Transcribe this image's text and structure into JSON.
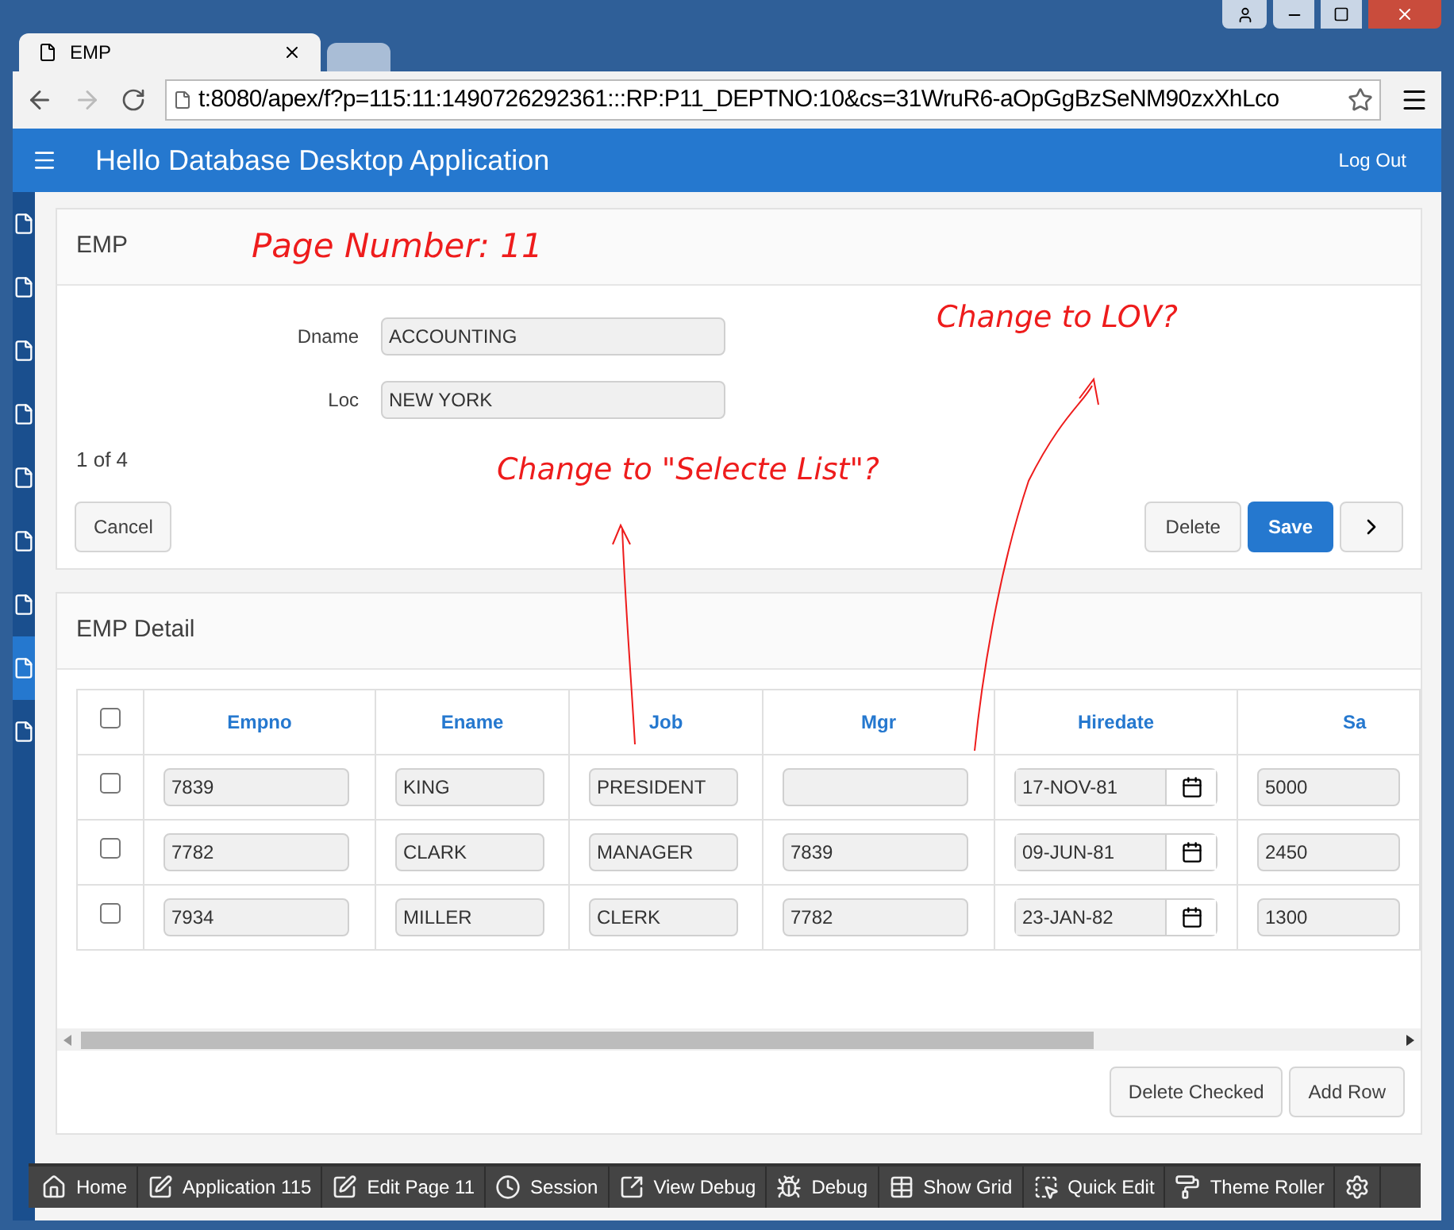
{
  "browser": {
    "tabs": [
      {
        "title": "EMP",
        "selected": true
      },
      {
        "selected": false
      }
    ],
    "address": "t:8080/apex/f?p=115:11:1490726292361:::RP:P11_DEPTNO:10&cs=31WruR6-aOpGgBzSeNM90zxXhLco"
  },
  "header": {
    "title": "Hello Database Desktop Application",
    "logout": "Log Out"
  },
  "sidebar": {
    "items": [
      {
        "selected": false
      },
      {
        "selected": false
      },
      {
        "selected": false
      },
      {
        "selected": false
      },
      {
        "selected": false
      },
      {
        "selected": false
      },
      {
        "selected": false
      },
      {
        "selected": true
      },
      {
        "selected": false
      }
    ]
  },
  "form": {
    "title": "EMP",
    "fields": [
      {
        "label": "Dname",
        "value": "ACCOUNTING"
      },
      {
        "label": "Loc",
        "value": "NEW YORK"
      }
    ],
    "pagination": "1 of 4",
    "buttons": {
      "cancel": "Cancel",
      "delete": "Delete",
      "save": "Save"
    }
  },
  "detail": {
    "title": "EMP Detail",
    "select_all_checked": false,
    "columns": [
      "Empno",
      "Ename",
      "Job",
      "Mgr",
      "Hiredate",
      "Sa"
    ],
    "rows": [
      {
        "checked": false,
        "cells": [
          "7839",
          "KING",
          "PRESIDENT",
          "",
          "17-NOV-81",
          "5000"
        ]
      },
      {
        "checked": false,
        "cells": [
          "7782",
          "CLARK",
          "MANAGER",
          "7839",
          "09-JUN-81",
          "2450"
        ]
      },
      {
        "checked": false,
        "cells": [
          "7934",
          "MILLER",
          "CLERK",
          "7782",
          "23-JAN-82",
          "1300"
        ]
      }
    ],
    "buttons": [
      "Delete Checked",
      "Add Row"
    ]
  },
  "annotations": [
    "Page Number: 11",
    "Change to LOV?",
    "Change to \"Selecte List\"?"
  ],
  "dev_toolbar": [
    {
      "kind": "home",
      "label": "Home"
    },
    {
      "kind": "app",
      "label": "Application 115"
    },
    {
      "kind": "edit",
      "label": "Edit Page 11"
    },
    {
      "kind": "session",
      "label": "Session"
    },
    {
      "kind": "viewdebug",
      "label": "View Debug"
    },
    {
      "kind": "debug",
      "label": "Debug"
    },
    {
      "kind": "grid",
      "label": "Show Grid"
    },
    {
      "kind": "quickedit",
      "label": "Quick Edit"
    },
    {
      "kind": "theme",
      "label": "Theme Roller"
    },
    {
      "kind": "settings"
    }
  ]
}
